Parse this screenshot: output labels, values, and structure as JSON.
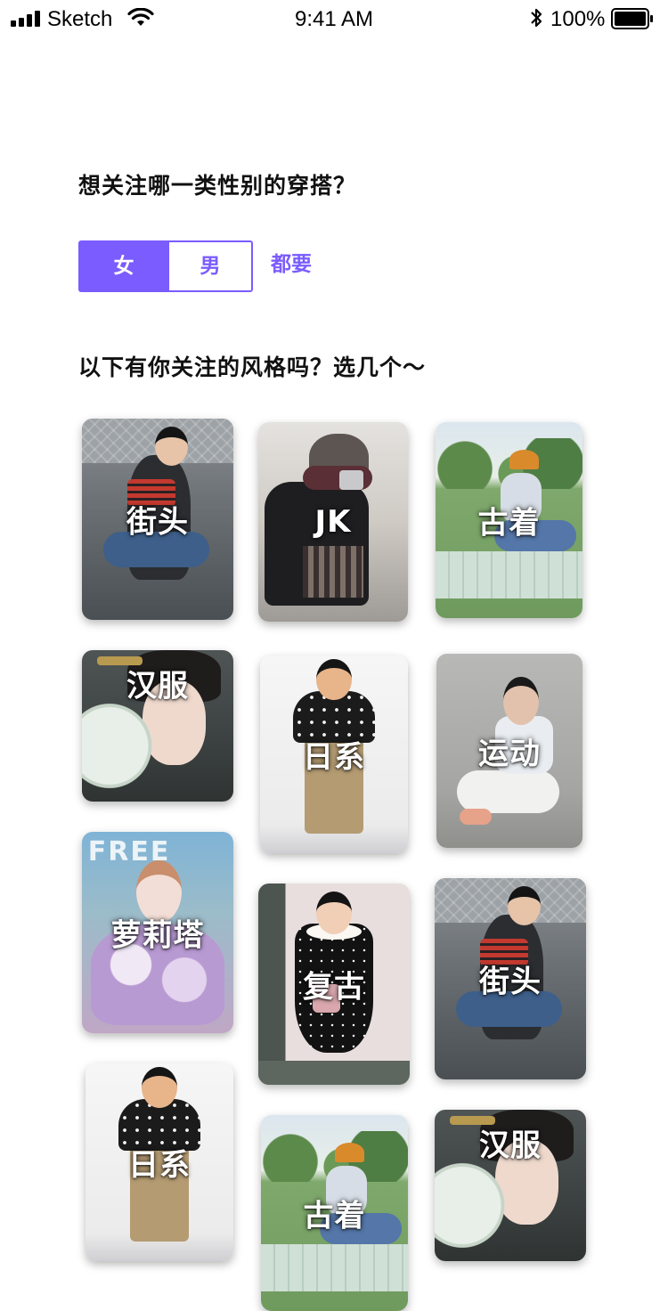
{
  "status_bar": {
    "carrier": "Sketch",
    "time": "9:41 AM",
    "battery": "100%"
  },
  "gender_question": {
    "title": "想关注哪一类性别的穿搭？",
    "options": [
      {
        "label": "女",
        "selected": true
      },
      {
        "label": "男",
        "selected": false
      },
      {
        "label": "都要",
        "selected": false
      }
    ]
  },
  "style_question": {
    "title": "以下有你关注的风格吗？选几个～"
  },
  "style_cards": [
    {
      "label": "街头",
      "icon": "street-photo"
    },
    {
      "label": "JK",
      "icon": "jk-photo"
    },
    {
      "label": "古着",
      "icon": "park-photo"
    },
    {
      "label": "汉服",
      "icon": "hanfu-photo"
    },
    {
      "label": "日系",
      "icon": "japanese-photo"
    },
    {
      "label": "运动",
      "icon": "sport-photo"
    },
    {
      "label": "萝莉塔",
      "icon": "lolita-photo"
    },
    {
      "label": "复古",
      "icon": "vintage-photo"
    },
    {
      "label": "街头",
      "icon": "street-photo"
    },
    {
      "label": "日系",
      "icon": "japanese-photo"
    },
    {
      "label": "古着",
      "icon": "park-photo"
    },
    {
      "label": "汉服",
      "icon": "hanfu-photo"
    }
  ],
  "photo_signs": {
    "lolita_banner": "FREE"
  },
  "colors": {
    "accent": "#7a5cff",
    "text": "#111111",
    "background": "#ffffff"
  }
}
